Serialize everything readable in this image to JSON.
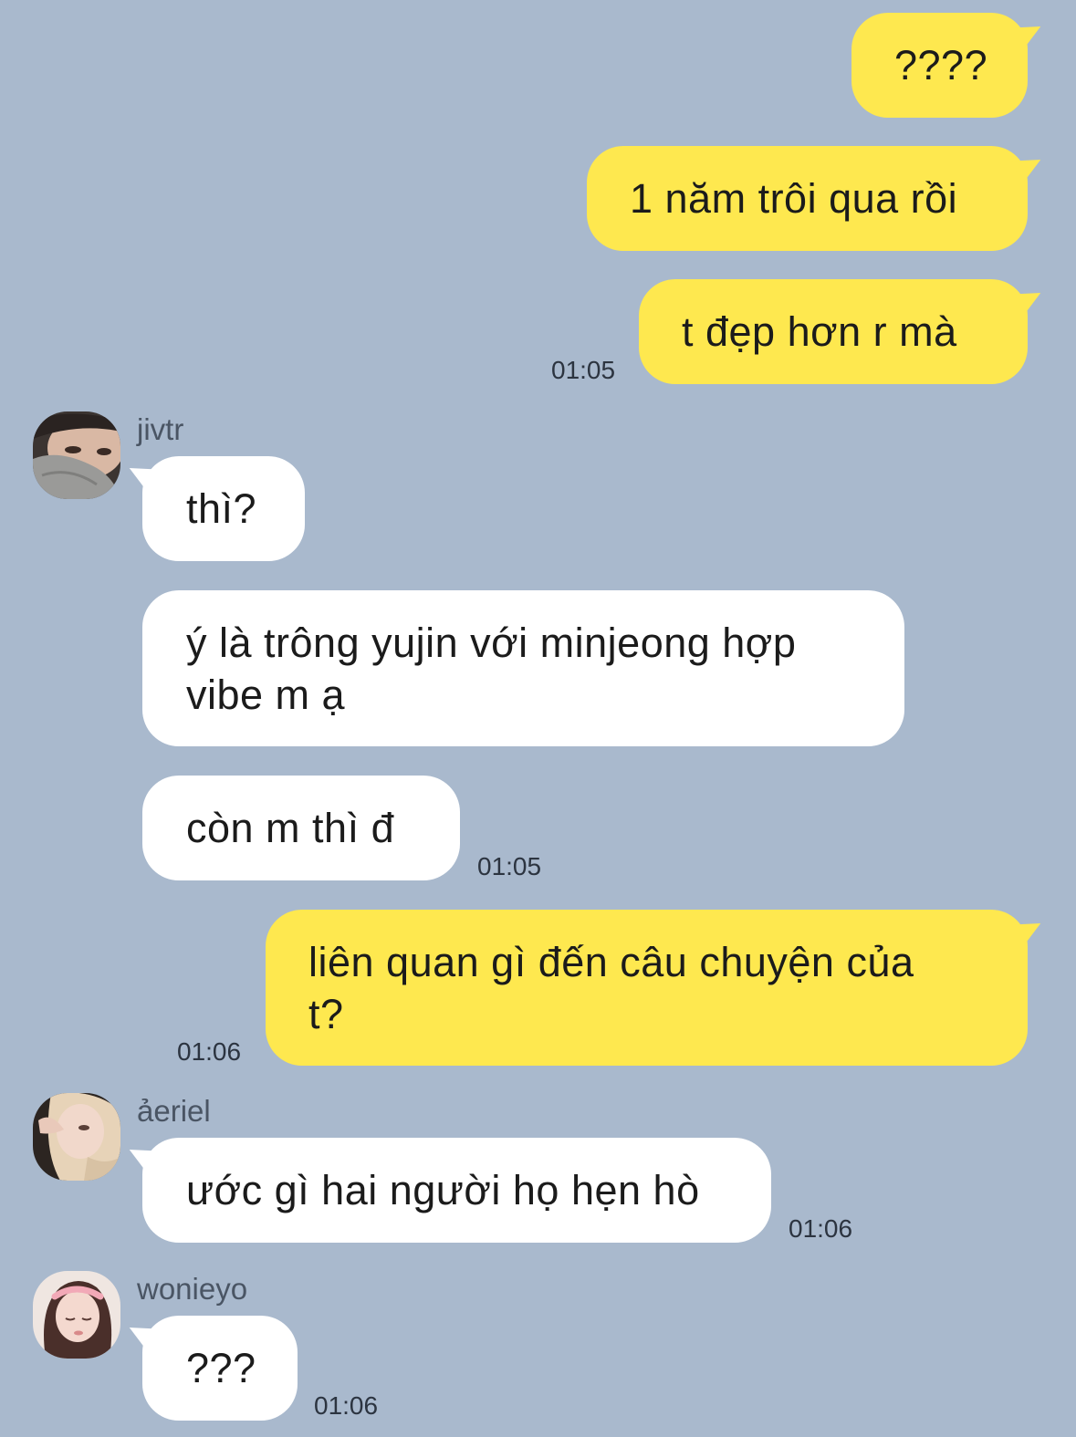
{
  "messages": {
    "m1": {
      "text": "????"
    },
    "m2": {
      "text": "1 năm trôi qua rồi"
    },
    "m3": {
      "text": "t đẹp hơn r mà",
      "time": "01:05"
    },
    "m4": {
      "sender": "jivtr",
      "text": "thì?"
    },
    "m5": {
      "line1": "ý là trông yujin với minjeong hợp",
      "line2": "vibe m ạ"
    },
    "m6": {
      "text": "còn m thì đ",
      "time": "01:05"
    },
    "m7": {
      "line1": "liên quan gì đến câu chuyện của",
      "line2": "t?",
      "time": "01:06"
    },
    "m8": {
      "sender": "ảeriel",
      "text": "ước gì hai người họ hẹn hò",
      "time": "01:06"
    },
    "m9": {
      "sender": "wonieyo",
      "text": "???",
      "time": "01:06"
    }
  },
  "colors": {
    "background": "#a9b9cd",
    "my_bubble": "#fee84f",
    "their_bubble": "#ffffff"
  }
}
